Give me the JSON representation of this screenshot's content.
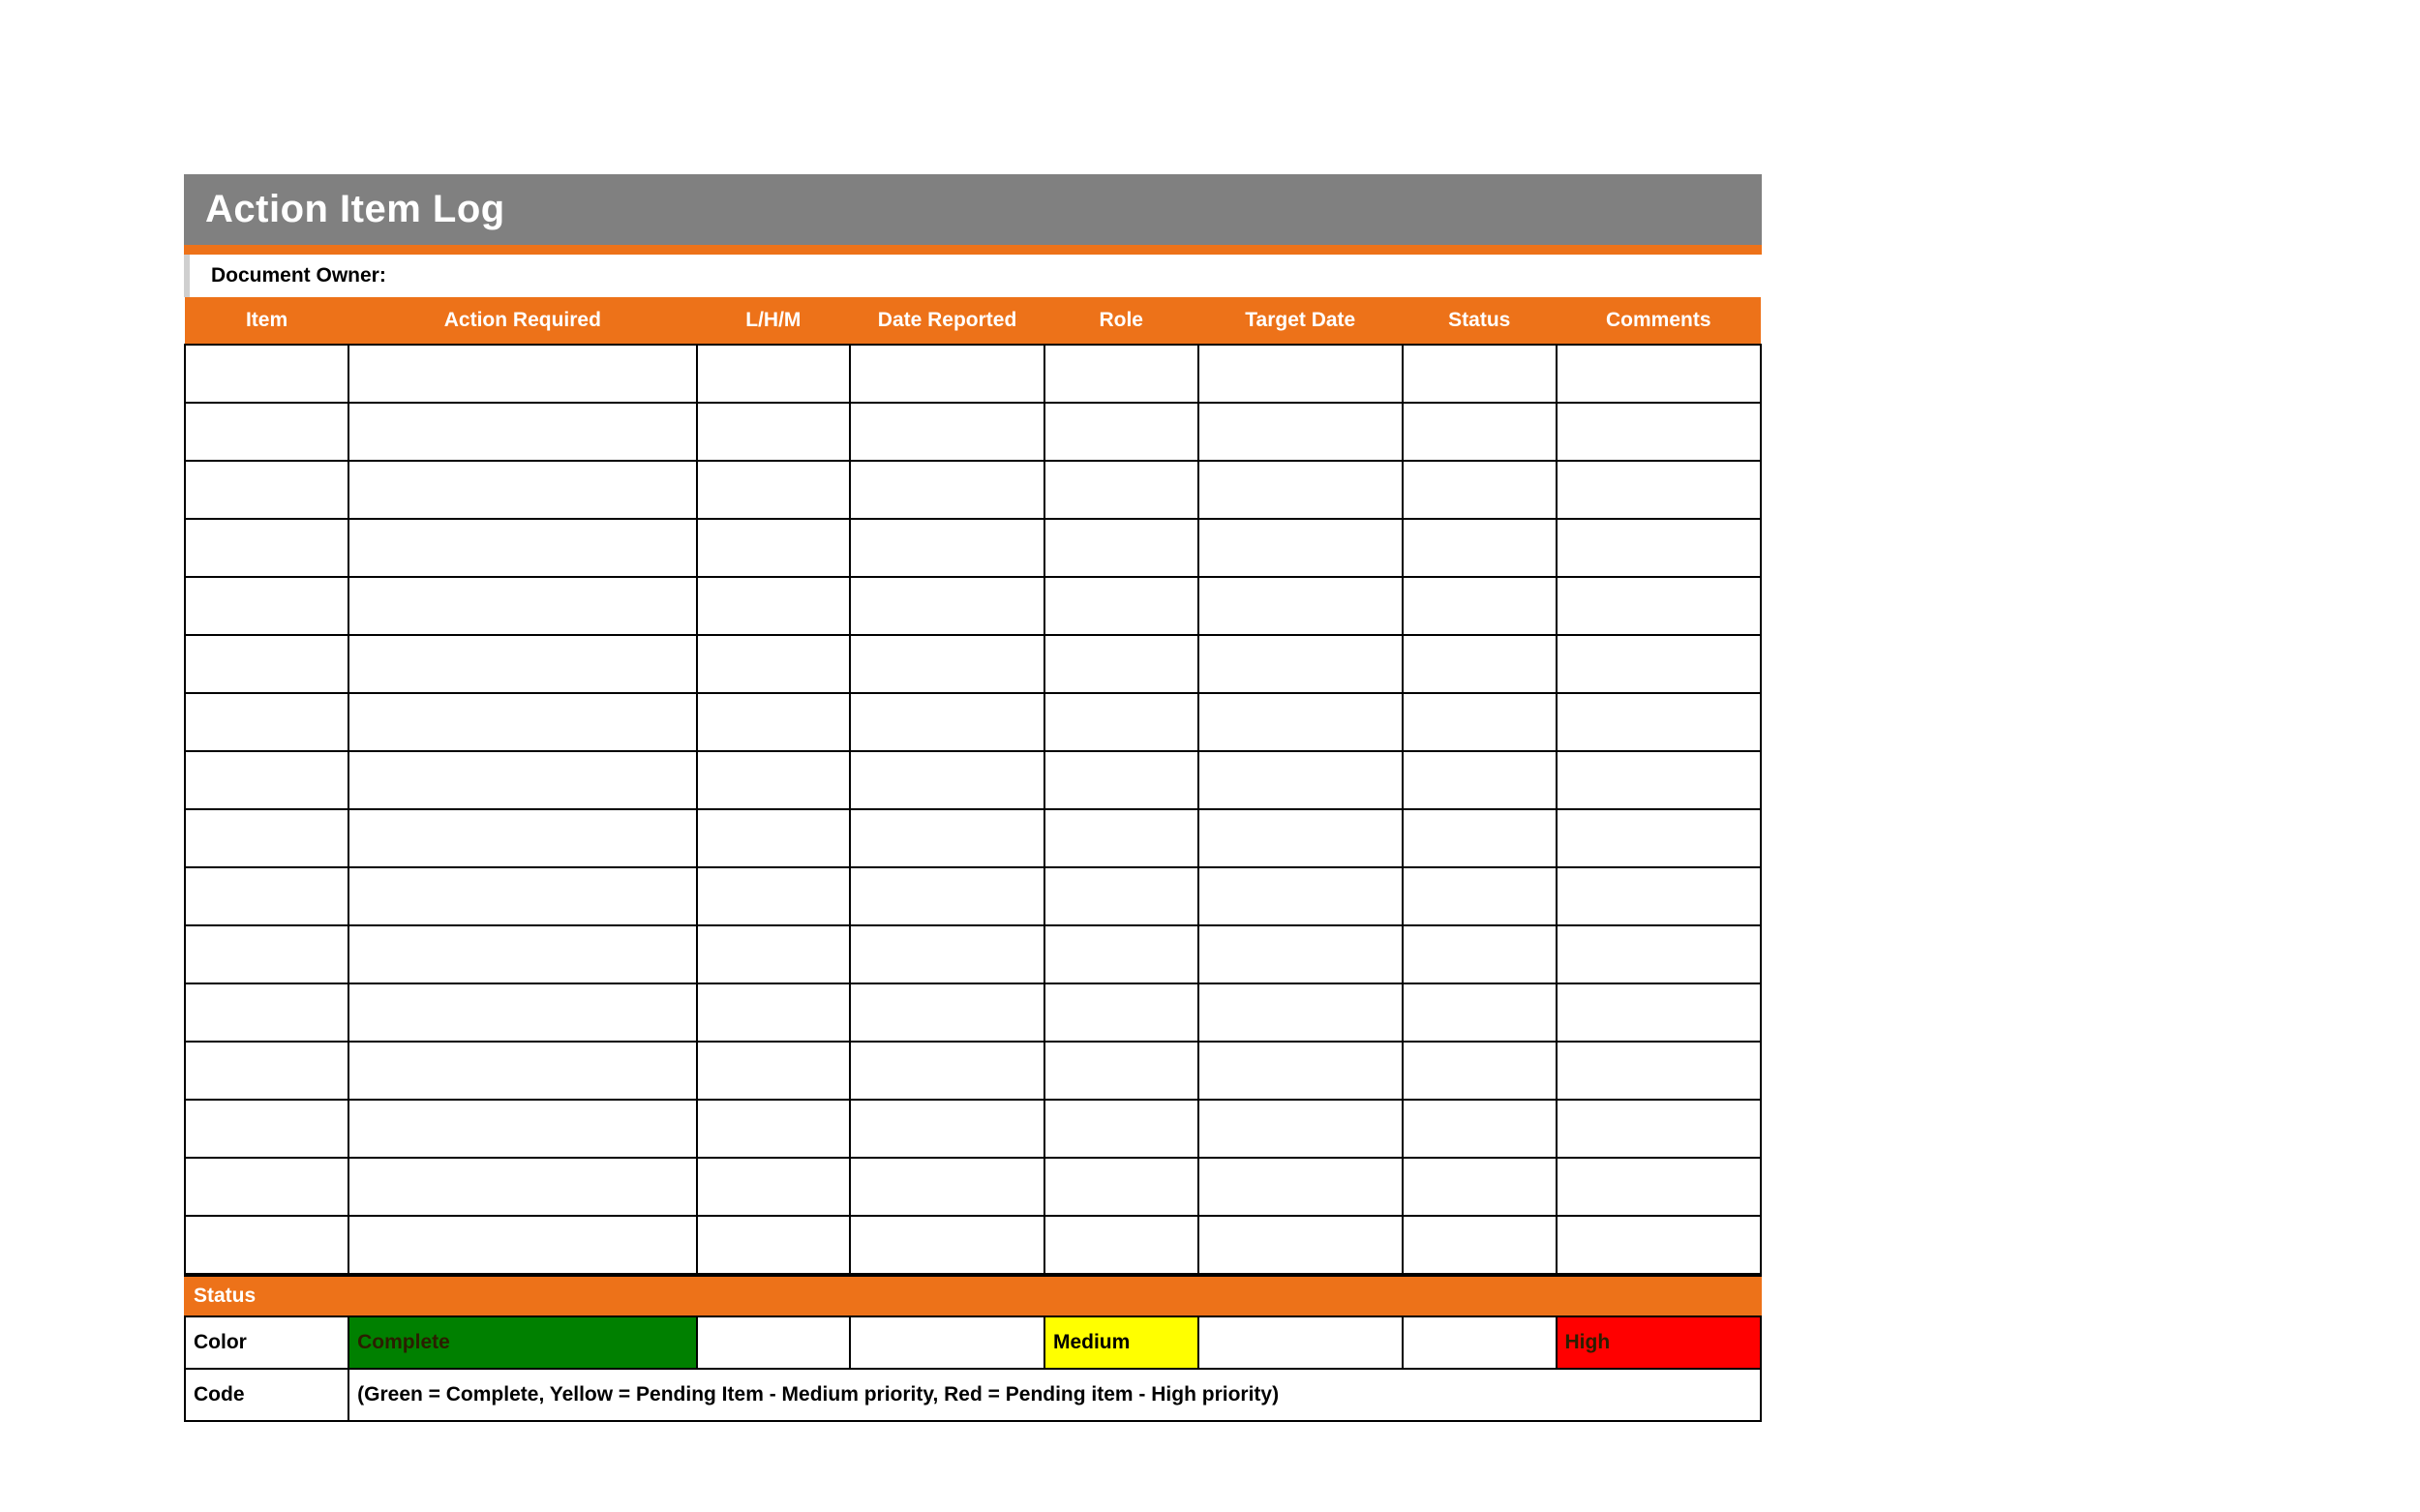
{
  "title": "Action Item Log",
  "document_owner_label": "Document Owner:",
  "columns": {
    "item": "Item",
    "action": "Action Required",
    "lhm": "L/H/M",
    "date_reported": "Date Reported",
    "role": "Role",
    "target_date": "Target Date",
    "status": "Status",
    "comments": "Comments"
  },
  "rows": [
    {
      "item": "",
      "action": "",
      "lhm": "",
      "date_reported": "",
      "role": "",
      "target_date": "",
      "status": "",
      "comments": ""
    },
    {
      "item": "",
      "action": "",
      "lhm": "",
      "date_reported": "",
      "role": "",
      "target_date": "",
      "status": "",
      "comments": ""
    },
    {
      "item": "",
      "action": "",
      "lhm": "",
      "date_reported": "",
      "role": "",
      "target_date": "",
      "status": "",
      "comments": ""
    },
    {
      "item": "",
      "action": "",
      "lhm": "",
      "date_reported": "",
      "role": "",
      "target_date": "",
      "status": "",
      "comments": ""
    },
    {
      "item": "",
      "action": "",
      "lhm": "",
      "date_reported": "",
      "role": "",
      "target_date": "",
      "status": "",
      "comments": ""
    },
    {
      "item": "",
      "action": "",
      "lhm": "",
      "date_reported": "",
      "role": "",
      "target_date": "",
      "status": "",
      "comments": ""
    },
    {
      "item": "",
      "action": "",
      "lhm": "",
      "date_reported": "",
      "role": "",
      "target_date": "",
      "status": "",
      "comments": ""
    },
    {
      "item": "",
      "action": "",
      "lhm": "",
      "date_reported": "",
      "role": "",
      "target_date": "",
      "status": "",
      "comments": ""
    },
    {
      "item": "",
      "action": "",
      "lhm": "",
      "date_reported": "",
      "role": "",
      "target_date": "",
      "status": "",
      "comments": ""
    },
    {
      "item": "",
      "action": "",
      "lhm": "",
      "date_reported": "",
      "role": "",
      "target_date": "",
      "status": "",
      "comments": ""
    },
    {
      "item": "",
      "action": "",
      "lhm": "",
      "date_reported": "",
      "role": "",
      "target_date": "",
      "status": "",
      "comments": ""
    },
    {
      "item": "",
      "action": "",
      "lhm": "",
      "date_reported": "",
      "role": "",
      "target_date": "",
      "status": "",
      "comments": ""
    },
    {
      "item": "",
      "action": "",
      "lhm": "",
      "date_reported": "",
      "role": "",
      "target_date": "",
      "status": "",
      "comments": ""
    },
    {
      "item": "",
      "action": "",
      "lhm": "",
      "date_reported": "",
      "role": "",
      "target_date": "",
      "status": "",
      "comments": ""
    },
    {
      "item": "",
      "action": "",
      "lhm": "",
      "date_reported": "",
      "role": "",
      "target_date": "",
      "status": "",
      "comments": ""
    },
    {
      "item": "",
      "action": "",
      "lhm": "",
      "date_reported": "",
      "role": "",
      "target_date": "",
      "status": "",
      "comments": ""
    }
  ],
  "legend": {
    "section_label": "Status",
    "color_label": "Color",
    "code_label": "Code",
    "swatches": {
      "complete": "Complete",
      "medium": "Medium",
      "high": "High"
    },
    "code_text": "(Green = Complete, Yellow = Pending Item - Medium priority,  Red = Pending item - High priority)"
  },
  "colors": {
    "orange": "#ed7219",
    "grey": "#808080",
    "green": "#008000",
    "yellow": "#ffff00",
    "red": "#ff0000"
  }
}
